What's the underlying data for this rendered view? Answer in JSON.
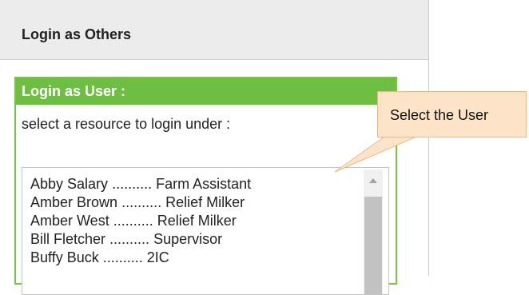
{
  "panel": {
    "title": "Login as Others"
  },
  "user_box": {
    "header": "Login as User :",
    "subtitle": "select a resource to login under :",
    "list": [
      {
        "name": "Abby Salary",
        "separator": "..........",
        "role": "Farm Assistant"
      },
      {
        "name": "Amber Brown",
        "separator": "..........",
        "role": "Relief Milker"
      },
      {
        "name": "Amber West",
        "separator": "..........",
        "role": "Relief Milker"
      },
      {
        "name": "Bill Fletcher",
        "separator": "..........",
        "role": "Supervisor"
      },
      {
        "name": "Buffy Buck",
        "separator": "..........",
        "role": "2IC"
      }
    ]
  },
  "callout": {
    "text": "Select the User"
  },
  "colors": {
    "header_gray": "#ececec",
    "accent_green": "#6fbe44",
    "callout_fill": "#fde4c9",
    "callout_border": "#e7b989"
  },
  "icons": {
    "scroll_up": "scroll-up-arrow-icon"
  }
}
